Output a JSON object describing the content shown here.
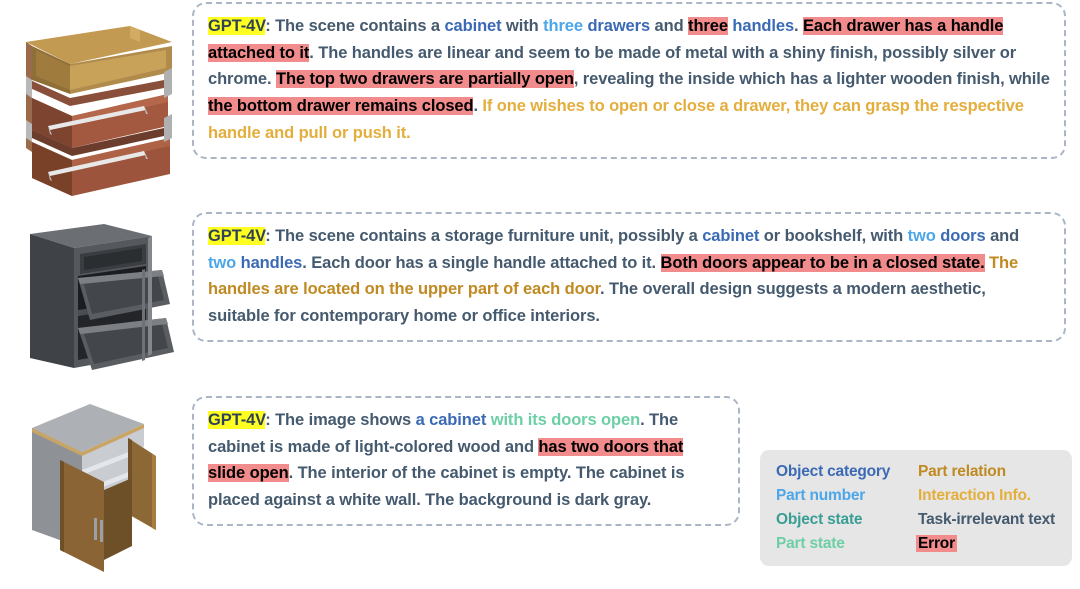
{
  "legend": {
    "items": [
      {
        "label": "Object category",
        "style": "objcat"
      },
      {
        "label": "Part relation",
        "style": "partrel"
      },
      {
        "label": "Part number",
        "style": "partnum"
      },
      {
        "label": "Interaction Info.",
        "style": "interact"
      },
      {
        "label": "Object state",
        "style": "objstate"
      },
      {
        "label": "Task-irrelevant text",
        "style": "plain"
      },
      {
        "label": "Part state",
        "style": "partstate"
      },
      {
        "label": "Error",
        "style": "error"
      }
    ],
    "colors": {
      "objcat": "#3b6ab5",
      "partnum": "#4da6e8",
      "objstate": "#3a9e94",
      "partstate": "#6dcfa5",
      "partrel": "#c08a22",
      "interact": "#e3ae3c",
      "plain": "#455a6e",
      "error_bg": "#f28c8c",
      "error_fg": "#000000",
      "speaker_bg": "#ffff22"
    }
  },
  "rows": [
    {
      "thumb_name": "wooden-drawer-cabinet-thumbnail",
      "speaker": "GPT-4V",
      "tokens": [
        {
          "t": "GPT-4V",
          "s": "speaker"
        },
        {
          "t": ": The scene contains a ",
          "s": "plain"
        },
        {
          "t": "cabinet",
          "s": "objcat"
        },
        {
          "t": " with ",
          "s": "plain"
        },
        {
          "t": "three",
          "s": "partnum"
        },
        {
          "t": " ",
          "s": "plain"
        },
        {
          "t": "drawers",
          "s": "objcat"
        },
        {
          "t": " and ",
          "s": "plain"
        },
        {
          "t": "three",
          "s": "error"
        },
        {
          "t": " ",
          "s": "plain"
        },
        {
          "t": "handles",
          "s": "objcat"
        },
        {
          "t": ". ",
          "s": "plain"
        },
        {
          "t": "Each drawer has a handle attached to it",
          "s": "error"
        },
        {
          "t": ". The handles are linear and seem to be made of metal with a shiny finish, possibly silver or chrome. ",
          "s": "plain"
        },
        {
          "t": "The top two drawers are partially open",
          "s": "error"
        },
        {
          "t": ", revealing the inside which has a lighter wooden finish, while ",
          "s": "plain"
        },
        {
          "t": "the bottom drawer remains closed",
          "s": "error"
        },
        {
          "t": ". ",
          "s": "plain"
        },
        {
          "t": "If one wishes to open or close a drawer, they can grasp the respective handle and pull or push it.",
          "s": "interact"
        }
      ]
    },
    {
      "thumb_name": "dark-gray-two-door-cabinet-thumbnail",
      "speaker": "GPT-4V",
      "tokens": [
        {
          "t": "GPT-4V",
          "s": "speaker"
        },
        {
          "t": ": The scene contains a storage furniture unit, possibly a ",
          "s": "plain"
        },
        {
          "t": "cabinet",
          "s": "objcat"
        },
        {
          "t": " or bookshelf, with ",
          "s": "plain"
        },
        {
          "t": "two",
          "s": "partnum"
        },
        {
          "t": " ",
          "s": "plain"
        },
        {
          "t": "doors",
          "s": "objcat"
        },
        {
          "t": " and ",
          "s": "plain"
        },
        {
          "t": "two",
          "s": "partnum"
        },
        {
          "t": " ",
          "s": "plain"
        },
        {
          "t": "handles",
          "s": "objcat"
        },
        {
          "t": ". Each door has a single handle attached to it. ",
          "s": "plain"
        },
        {
          "t": "Both doors appear to be in a closed state.",
          "s": "error"
        },
        {
          "t": " ",
          "s": "plain"
        },
        {
          "t": "The handles are located on the upper part of each door",
          "s": "partrel"
        },
        {
          "t": ". The overall design suggests a modern aesthetic, suitable for contemporary home or office interiors.",
          "s": "plain"
        }
      ]
    },
    {
      "thumb_name": "light-wood-open-door-cabinet-thumbnail",
      "speaker": "GPT-4V",
      "tokens": [
        {
          "t": "GPT-4V",
          "s": "speaker"
        },
        {
          "t": ": The image shows ",
          "s": "plain"
        },
        {
          "t": "a cabinet",
          "s": "objcat"
        },
        {
          "t": " ",
          "s": "plain"
        },
        {
          "t": "with its doors open",
          "s": "partstate"
        },
        {
          "t": ". The cabinet is made of light-colored wood and ",
          "s": "plain"
        },
        {
          "t": "has two doors that slide open",
          "s": "error"
        },
        {
          "t": ". The interior of the cabinet is empty. The cabinet is placed against a white wall. The background is dark gray.",
          "s": "plain"
        }
      ]
    }
  ]
}
